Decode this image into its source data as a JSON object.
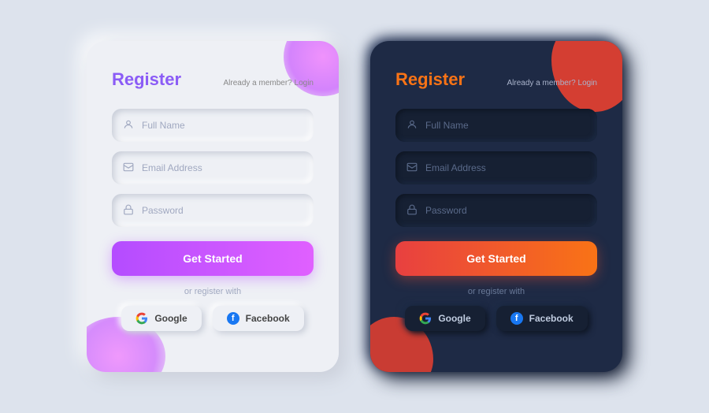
{
  "light": {
    "title": "Register",
    "already_member": "Already a member? Login",
    "fields": [
      {
        "placeholder": "Full Name",
        "type": "text",
        "icon": "👤"
      },
      {
        "placeholder": "Email Address",
        "type": "email",
        "icon": "✉"
      },
      {
        "placeholder": "Password",
        "type": "password",
        "icon": "🔒"
      }
    ],
    "button": "Get Started",
    "or_text": "or register with",
    "social": [
      {
        "label": "Google"
      },
      {
        "label": "Facebook"
      }
    ]
  },
  "dark": {
    "title": "Register",
    "already_member": "Already a member? Login",
    "fields": [
      {
        "placeholder": "Full Name",
        "type": "text",
        "icon": "👤"
      },
      {
        "placeholder": "Email Address",
        "type": "email",
        "icon": "✉"
      },
      {
        "placeholder": "Password",
        "type": "password",
        "icon": "🔒"
      }
    ],
    "button": "Get Started",
    "or_text": "or register with",
    "social": [
      {
        "label": "Google"
      },
      {
        "label": "Facebook"
      }
    ]
  }
}
